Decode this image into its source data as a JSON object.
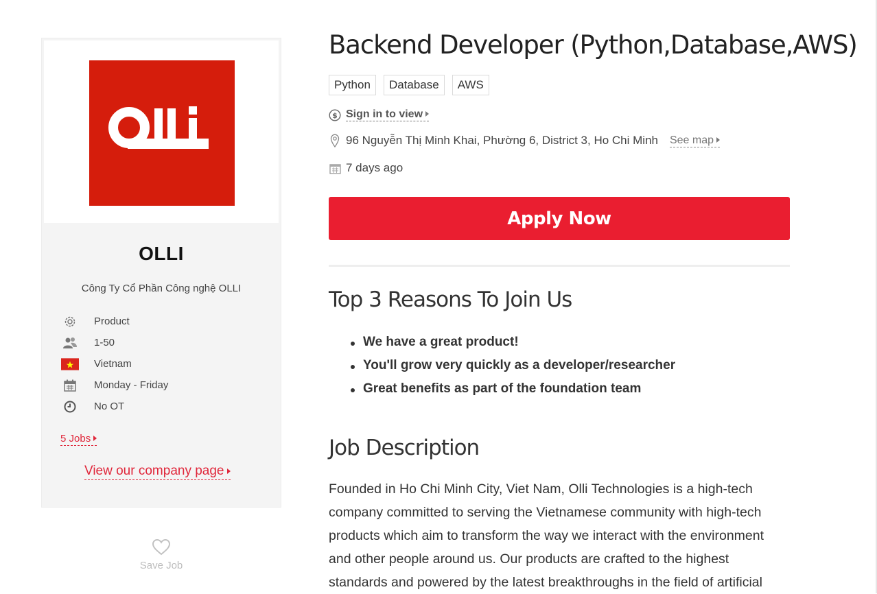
{
  "company": {
    "logo_text": "OLLI",
    "name": "OLLI",
    "legal_name": "Công Ty Cổ Phần Công nghệ OLLI",
    "info": [
      {
        "icon": "gear-icon",
        "text": "Product"
      },
      {
        "icon": "people-icon",
        "text": "1-50"
      },
      {
        "icon": "vietnam-flag-icon",
        "text": "Vietnam"
      },
      {
        "icon": "calendar-icon",
        "text": "Monday - Friday"
      },
      {
        "icon": "clock-icon",
        "text": "No OT"
      }
    ],
    "jobs_link": "5 Jobs",
    "company_page_link": "View our company page",
    "save_job_label": "Save Job"
  },
  "job": {
    "title": "Backend Developer (Python,Database,AWS)",
    "tags": [
      "Python",
      "Database",
      "AWS"
    ],
    "salary_link": "Sign in to view",
    "address": "96 Nguyễn Thị Minh Khai, Phường 6, District 3, Ho Chi Minh",
    "see_map": "See map",
    "posted": "7 days ago",
    "apply_label": "Apply Now"
  },
  "reasons": {
    "heading": "Top 3 Reasons To Join Us",
    "items": [
      "We have a great product!",
      "You'll grow very quickly as a developer/researcher",
      "Great benefits as part of the foundation team"
    ]
  },
  "description": {
    "heading": "Job Description",
    "lines": [
      "Founded in Ho Chi Minh City, Viet Nam, Olli Technologies is a high-tech",
      "company committed to serving the Vietnamese community with high-tech",
      "products which aim to transform the way we interact with the environment",
      "and other people around us. Our products are crafted to the highest",
      "standards and powered by the latest breakthroughs in the field of artificial"
    ]
  },
  "colors": {
    "brand_red": "#ea1e30",
    "logo_red": "#d51d0c",
    "link_red": "#e0263a"
  }
}
